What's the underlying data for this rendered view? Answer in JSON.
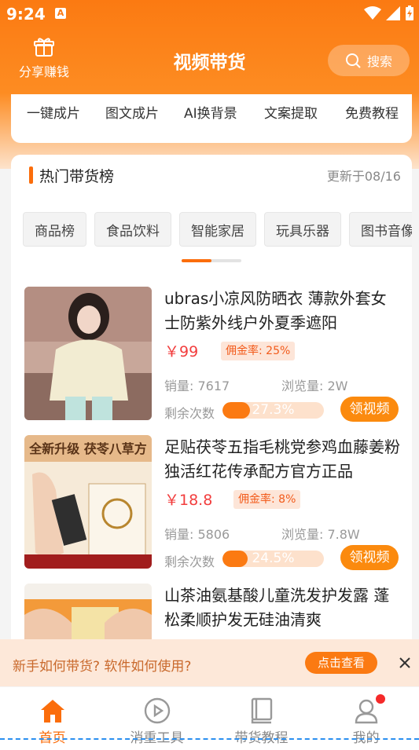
{
  "status_bar": {
    "time": "9:24",
    "app_icon": "A"
  },
  "header": {
    "share_label": "分享赚钱",
    "title": "视频带货",
    "search_label": "搜索"
  },
  "tools": [
    "一键成片",
    "图文成片",
    "AI换背景",
    "文案提取",
    "免费教程"
  ],
  "hot_section": {
    "title": "热门带货榜",
    "updated": "更新于08/16",
    "categories": [
      "商品榜",
      "食品饮料",
      "智能家居",
      "玩具乐器",
      "图书音像"
    ]
  },
  "products": [
    {
      "title": "ubras小凉风防晒衣 薄款外套女士防紫外线户外夏季遮阳",
      "price": "￥99",
      "commission": "佣金率: 25%",
      "sales": "销量: 7617",
      "views": "浏览量: 2W",
      "remain_label": "剩余次数",
      "remain_percent": 27.3,
      "remain_text": "27.3%",
      "button": "领视频"
    },
    {
      "title": "足贴茯苓五指毛桃党参鸡血藤姜粉独活红花传承配方官方正品",
      "price": "￥18.8",
      "commission": "佣金率: 8%",
      "sales": "销量: 5806",
      "views": "浏览量: 7.8W",
      "remain_label": "剩余次数",
      "remain_percent": 24.5,
      "remain_text": "24.5%",
      "button": "领视频",
      "thumb_banner": "全新升级 茯苓八草方"
    },
    {
      "title": "山茶油氨基酸儿童洗发护发露 蓬松柔顺护发无硅油清爽"
    }
  ],
  "tip_banner": {
    "text": "新手如何带货? 软件如何使用?",
    "button": "点击查看"
  },
  "bottom_nav": [
    {
      "label": "首页",
      "icon": "home-icon",
      "active": true
    },
    {
      "label": "消重工具",
      "icon": "play-circle-icon",
      "active": false
    },
    {
      "label": "带货教程",
      "icon": "book-icon",
      "active": false
    },
    {
      "label": "我的",
      "icon": "user-icon",
      "active": false
    }
  ],
  "colors": {
    "accent": "#fb7a12",
    "price": "#f23d3d",
    "active_nav": "#fb6d0b"
  }
}
